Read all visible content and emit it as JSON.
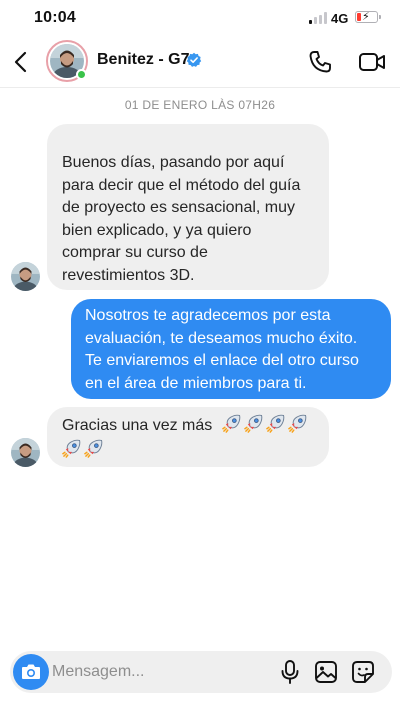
{
  "status_bar": {
    "time": "10:04",
    "network": "4G",
    "battery_level": 0.2,
    "battery_color": "#ff3b30"
  },
  "header": {
    "contact_name": "Benitez - G7",
    "verified": true,
    "online": true,
    "icons": [
      "back-chevron-icon",
      "verified-badge-icon",
      "phone-icon",
      "video-camera-icon"
    ]
  },
  "chat": {
    "date_separator": "01 DE ENERO LÀS 07H26",
    "messages": [
      {
        "direction": "incoming",
        "lines": [
          "Buenos días, pasando por aquí",
          "para decir que el método del guía",
          "de proyecto es sensacional, muy",
          "bien explicado, y ya quiero",
          "comprar su curso de",
          "revestimientos 3D."
        ]
      },
      {
        "direction": "outgoing",
        "lines": [
          "Nosotros te agradecemos por esta",
          "evaluación, te deseamos mucho éxito.",
          "Te enviaremos el enlace del otro curso",
          "en el área de miembros para ti."
        ]
      },
      {
        "direction": "incoming",
        "text": "Gracias una vez más",
        "emoji": "rocket",
        "emoji_count": 6
      }
    ]
  },
  "composer": {
    "placeholder": "Mensagem...",
    "icons": [
      "camera-icon",
      "microphone-icon",
      "gallery-icon",
      "sticker-icon"
    ]
  },
  "colors": {
    "accent_blue": "#2f8bf2",
    "incoming_bubble": "#efefef",
    "online_green": "#3ac34a"
  }
}
